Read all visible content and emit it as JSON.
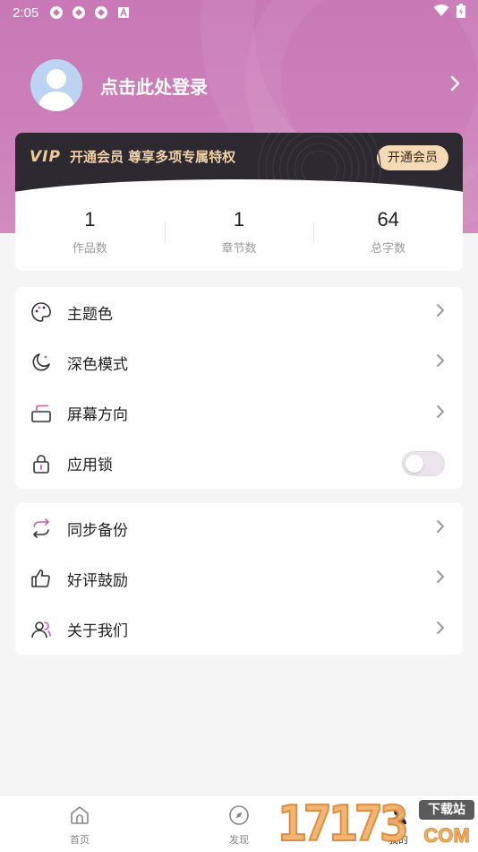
{
  "status_bar": {
    "time": "2:05",
    "left_icons": [
      "app-icon-1",
      "app-icon-2",
      "app-icon-3",
      "keyboard-a-icon"
    ],
    "right_icons": [
      "wifi-icon",
      "battery-icon"
    ]
  },
  "profile": {
    "login_text": "点击此处登录"
  },
  "vip": {
    "logo": "VIP",
    "text": "开通会员 尊享多项专属特权",
    "button": "开通会员"
  },
  "stats": [
    {
      "value": "1",
      "label": "作品数"
    },
    {
      "value": "1",
      "label": "章节数"
    },
    {
      "value": "64",
      "label": "总字数"
    }
  ],
  "menu_group1": [
    {
      "label": "主题色",
      "icon": "palette-icon"
    },
    {
      "label": "深色模式",
      "icon": "moon-icon"
    },
    {
      "label": "屏幕方向",
      "icon": "screen-rotate-icon"
    },
    {
      "label": "应用锁",
      "icon": "lock-icon",
      "toggle": false
    }
  ],
  "menu_group2": [
    {
      "label": "同步备份",
      "icon": "sync-icon"
    },
    {
      "label": "好评鼓励",
      "icon": "thumbs-up-icon"
    },
    {
      "label": "关于我们",
      "icon": "users-icon"
    }
  ],
  "bottom_nav": [
    {
      "label": "首页",
      "icon": "home-icon"
    },
    {
      "label": "发现",
      "icon": "compass-icon"
    },
    {
      "label": "我的",
      "icon": "user-icon"
    }
  ],
  "watermark": {
    "digits": "17173",
    "top": "下载站",
    "bottom": "COM"
  },
  "colors": {
    "header": "#c879b6",
    "accent": "#c060a8",
    "vip_bg": "#2c2a30",
    "vip_gold": "#f1d0a6"
  }
}
